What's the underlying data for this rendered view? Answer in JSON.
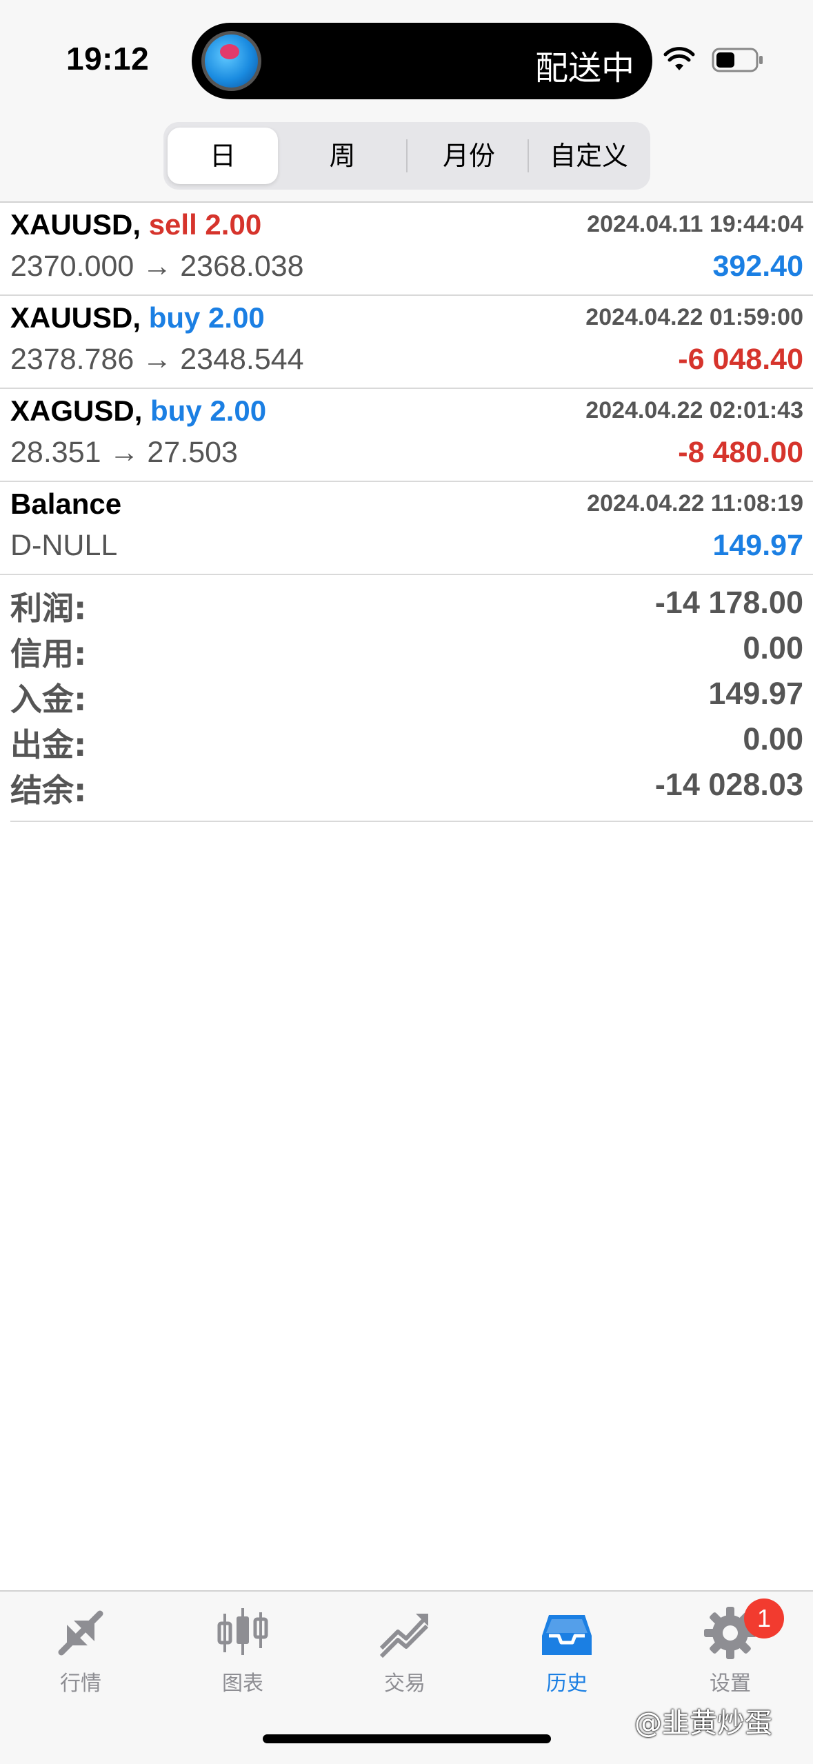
{
  "status_bar": {
    "time": "19:12",
    "island_text": "配送中"
  },
  "period_tabs": [
    {
      "label": "日",
      "active": true
    },
    {
      "label": "周",
      "active": false
    },
    {
      "label": "月份",
      "active": false
    },
    {
      "label": "自定义",
      "active": false
    }
  ],
  "deals": [
    {
      "symbol": "XAUUSD,",
      "action": "sell 2.00",
      "action_color": "#d6342c",
      "time": "2024.04.11 19:44:04",
      "prices": "2370.000 → 2368.038",
      "profit": "392.40",
      "profit_color": "#1b7fe3"
    },
    {
      "symbol": "XAUUSD,",
      "action": "buy 2.00",
      "action_color": "#1b7fe3",
      "time": "2024.04.22 01:59:00",
      "prices": "2378.786 → 2348.544",
      "profit": "-6 048.40",
      "profit_color": "#d6342c"
    },
    {
      "symbol": "XAGUSD,",
      "action": "buy 2.00",
      "action_color": "#1b7fe3",
      "time": "2024.04.22 02:01:43",
      "prices": "28.351 → 27.503",
      "profit": "-8 480.00",
      "profit_color": "#d6342c"
    },
    {
      "symbol": "Balance",
      "action": "",
      "action_color": "#000000",
      "time": "2024.04.22 11:08:19",
      "prices": "D-NULL",
      "profit": "149.97",
      "profit_color": "#1b7fe3"
    }
  ],
  "summary": [
    {
      "label": "利润:",
      "value": "-14 178.00"
    },
    {
      "label": "信用:",
      "value": "0.00"
    },
    {
      "label": "入金:",
      "value": "149.97"
    },
    {
      "label": "出金:",
      "value": "0.00"
    },
    {
      "label": "结余:",
      "value": "-14 028.03"
    }
  ],
  "tabbar": {
    "items": [
      {
        "label": "行情",
        "icon": "quotes-arrows-icon",
        "active": false
      },
      {
        "label": "图表",
        "icon": "candlestick-chart-icon",
        "active": false
      },
      {
        "label": "交易",
        "icon": "trade-trend-icon",
        "active": false
      },
      {
        "label": "历史",
        "icon": "history-inbox-icon",
        "active": true
      },
      {
        "label": "设置",
        "icon": "gear-icon",
        "active": false
      }
    ],
    "settings_badge": "1"
  },
  "watermark": "@韭黄炒蛋",
  "colors": {
    "accent_blue": "#1b7fe3",
    "loss_red": "#d6342c",
    "inactive_gray": "#8e8e93"
  }
}
